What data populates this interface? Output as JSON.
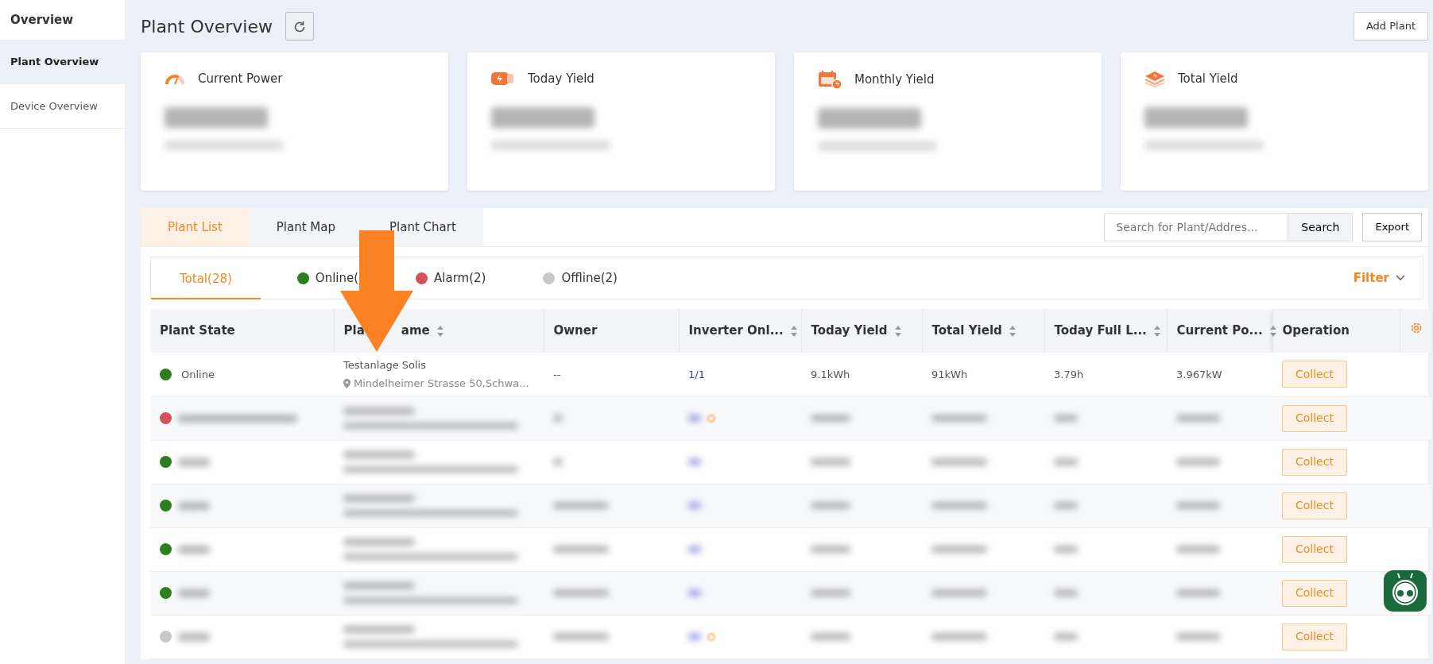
{
  "sidebar": {
    "title": "Overview",
    "items": [
      {
        "label": "Plant Overview",
        "selected": true
      },
      {
        "label": "Device Overview",
        "selected": false
      }
    ]
  },
  "header": {
    "title": "Plant Overview",
    "add_button": "Add Plant"
  },
  "stats": [
    {
      "kind": "power",
      "label": "Current Power"
    },
    {
      "kind": "today",
      "label": "Today Yield"
    },
    {
      "kind": "monthly",
      "label": "Monthly Yield"
    },
    {
      "kind": "total",
      "label": "Total Yield"
    }
  ],
  "view_tabs": [
    {
      "label": "Plant List",
      "selected": true
    },
    {
      "label": "Plant Map",
      "selected": false
    },
    {
      "label": "Plant Chart",
      "selected": false
    }
  ],
  "search": {
    "placeholder": "Search for Plant/Addres...",
    "button": "Search"
  },
  "export_button": "Export",
  "state_tabs": [
    {
      "label": "Total(28)",
      "selected": true
    },
    {
      "label": "Online(",
      "selected": false,
      "color": "#2e7d1e"
    },
    {
      "label": "Alarm(2)",
      "selected": false,
      "color": "#d9505c"
    },
    {
      "label": "Offline(2)",
      "selected": false,
      "color": "#c8c8c8"
    }
  ],
  "filter": "Filter",
  "table": {
    "columns": [
      {
        "label": "Plant State",
        "sortable": false
      },
      {
        "label": "Pla",
        "label_rest": "ame",
        "sortable": true
      },
      {
        "label": "Owner",
        "sortable": false
      },
      {
        "label": "Inverter Onl...",
        "sortable": true
      },
      {
        "label": "Today Yield",
        "sortable": true
      },
      {
        "label": "Total Yield",
        "sortable": true
      },
      {
        "label": "Today Full L...",
        "sortable": true
      },
      {
        "label": "Current Po...",
        "sortable": true
      },
      {
        "label": "Operation",
        "sortable": false
      }
    ],
    "rows": [
      {
        "kind": "clear",
        "color": "#2e7d1e",
        "state": "Online",
        "name": "Testanlage Solis",
        "address": "Mindelheimer Strasse 50,Schwa...",
        "owner": "--",
        "inverter_online": "1/1",
        "today_yield": "9.1kWh",
        "total_yield": "91kWh",
        "today_full_load": "3.79h",
        "current_power": "3.967kW",
        "action": "Collect"
      },
      {
        "kind": "blurred",
        "color": "#d9505c",
        "warning": true,
        "action": "Collect"
      },
      {
        "kind": "blurred",
        "color": "#2e7d1e",
        "warning": false,
        "action": "Collect"
      },
      {
        "kind": "blurred",
        "color": "#2e7d1e",
        "warning": false,
        "action": "Collect"
      },
      {
        "kind": "blurred",
        "color": "#2e7d1e",
        "warning": false,
        "action": "Collect"
      },
      {
        "kind": "blurred",
        "color": "#2e7d1e",
        "warning": false,
        "action": "Collect"
      },
      {
        "kind": "blurred",
        "color": "#c8c8c8",
        "warning": true,
        "action": "Collect"
      }
    ]
  }
}
